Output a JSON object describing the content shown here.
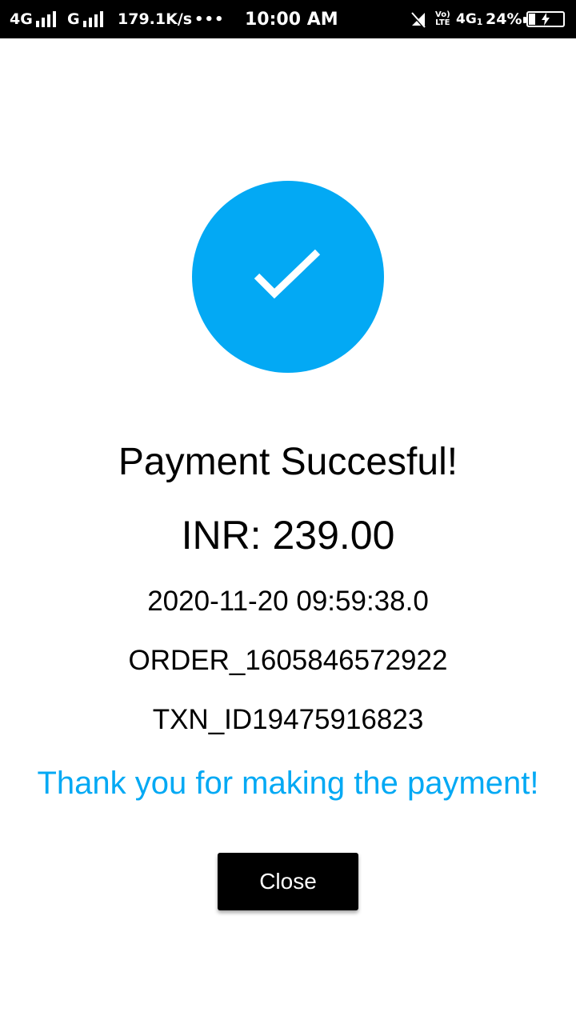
{
  "status_bar": {
    "network1": "4G",
    "network2": "G",
    "speed": "179.1K/s",
    "more_dots": "•••",
    "time": "10:00 AM",
    "volte_top": "Vo)",
    "volte_bottom": "LTE",
    "network3": "4G",
    "network3_sub": "1",
    "battery_percent": "24%",
    "battery_level": 0.24,
    "icons": [
      "signal-bars-icon",
      "mute-icon",
      "battery-charging-icon"
    ]
  },
  "payment": {
    "status_icon": "checkmark-icon",
    "accent_color": "#03a9f4",
    "title": "Payment Succesful!",
    "amount": "INR: 239.00",
    "datetime": "2020-11-20 09:59:38.0",
    "order_id": "ORDER_1605846572922",
    "txn_id": "TXN_ID19475916823",
    "thanks": "Thank you for making the payment!",
    "close_label": "Close"
  }
}
